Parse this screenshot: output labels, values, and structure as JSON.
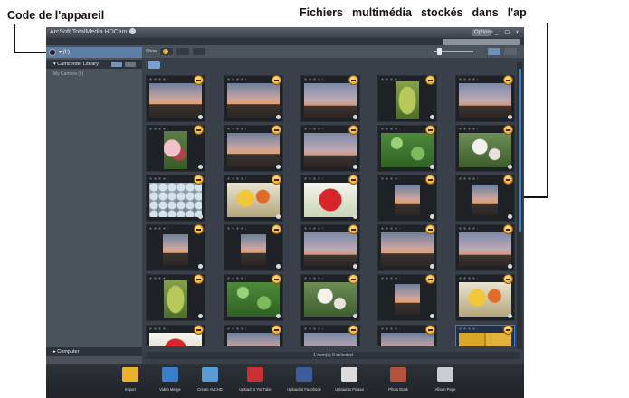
{
  "callouts": {
    "device_code": "Code de l'appareil",
    "media_stored_words": [
      "Fichiers",
      "multimédia",
      "stockés",
      "dans",
      "l'ap"
    ]
  },
  "app": {
    "title": "ArcSoft TotalMedia HDCam",
    "window_buttons": [
      "Options",
      "_",
      "▢",
      "x"
    ],
    "sidebar": {
      "device_label": "▾ (I:)",
      "library_label": "▾ Camcorder Library",
      "library_item": "My Camera (I:)",
      "computer_label": "▸ Computer"
    },
    "toolbar": {
      "show_label": "Show"
    },
    "status": "1 item(s) 9 selected",
    "colors": {
      "accent": "#3a82c9",
      "badge": "#e69a1a",
      "background": "#3c434c"
    },
    "thumbnails": [
      {
        "kind": "sunset",
        "size": "full"
      },
      {
        "kind": "sunset",
        "size": "full"
      },
      {
        "kind": "dusk",
        "size": "full"
      },
      {
        "kind": "green-bud",
        "size": "portrait"
      },
      {
        "kind": "dusk",
        "size": "full"
      },
      {
        "kind": "flowers-pink",
        "size": "portrait"
      },
      {
        "kind": "sunset",
        "size": "full"
      },
      {
        "kind": "dusk",
        "size": "full"
      },
      {
        "kind": "leaves",
        "size": "full"
      },
      {
        "kind": "white-flowers",
        "size": "full"
      },
      {
        "kind": "frost",
        "size": "full"
      },
      {
        "kind": "yellow-flowers",
        "size": "full"
      },
      {
        "kind": "red-flower",
        "size": "full"
      },
      {
        "kind": "sunset",
        "size": "small"
      },
      {
        "kind": "sunset",
        "size": "small"
      },
      {
        "kind": "sunset",
        "size": "small"
      },
      {
        "kind": "sunset",
        "size": "small"
      },
      {
        "kind": "dusk",
        "size": "full"
      },
      {
        "kind": "sunset",
        "size": "full"
      },
      {
        "kind": "dusk",
        "size": "full"
      },
      {
        "kind": "green-bud",
        "size": "portrait"
      },
      {
        "kind": "leaves",
        "size": "full"
      },
      {
        "kind": "white-flowers",
        "size": "full"
      },
      {
        "kind": "sunset",
        "size": "small"
      },
      {
        "kind": "yellow-flowers",
        "size": "full"
      },
      {
        "kind": "red-flower",
        "size": "full"
      },
      {
        "kind": "sunset",
        "size": "full"
      },
      {
        "kind": "dusk",
        "size": "full"
      },
      {
        "kind": "sunset",
        "size": "full"
      },
      {
        "kind": "yellow-page",
        "size": "full",
        "selected": true
      }
    ],
    "bottom_actions": [
      {
        "label": "Import",
        "color": "#e9b12c",
        "icon": "import-icon"
      },
      {
        "label": "Video Merge",
        "color": "#3a7fc9",
        "icon": "video-merge-icon"
      },
      {
        "label": "Create AVCHD",
        "color": "#5a9bd6",
        "icon": "disc-icon"
      },
      {
        "label": "Upload to YouTube",
        "color": "#c83232",
        "icon": "youtube-icon"
      },
      {
        "label": "Upload to Facebook",
        "color": "#3b5b9a",
        "icon": "facebook-icon"
      },
      {
        "label": "Upload to Picasa",
        "color": "#dcdcdc",
        "icon": "picasa-icon"
      },
      {
        "label": "Photo Book",
        "color": "#b4533a",
        "icon": "photo-book-icon"
      },
      {
        "label": "Album Page",
        "color": "#c9ced4",
        "icon": "album-page-icon"
      }
    ]
  }
}
